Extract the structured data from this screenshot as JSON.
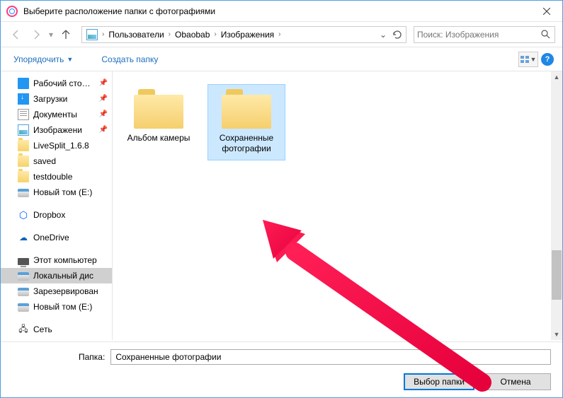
{
  "title": "Выберите расположение папки с фотографиями",
  "breadcrumb": {
    "c1": "Пользователи",
    "c2": "Obaobab",
    "c3": "Изображения"
  },
  "search": {
    "placeholder": "Поиск: Изображения"
  },
  "toolbar": {
    "organize": "Упорядочить",
    "newfolder": "Создать папку"
  },
  "sidebar": {
    "desktop": "Рабочий сто…",
    "downloads": "Загрузки",
    "documents": "Документы",
    "pictures": "Изображени",
    "livesplit": "LiveSplit_1.6.8",
    "saved": "saved",
    "testdouble": "testdouble",
    "newvol1": "Новый том (E:)",
    "dropbox": "Dropbox",
    "onedrive": "OneDrive",
    "thispc": "Этот компьютер",
    "localdisk": "Локальный дис",
    "reserved": "Зарезервирован",
    "newvol2": "Новый том (E:)",
    "network": "Сеть"
  },
  "folders": {
    "camera": "Альбом камеры",
    "saved_photos_l1": "Сохраненные",
    "saved_photos_l2": "фотографии"
  },
  "bottom": {
    "label": "Папка:",
    "value": "Сохраненные фотографии",
    "select": "Выбор папки",
    "cancel": "Отмена"
  }
}
